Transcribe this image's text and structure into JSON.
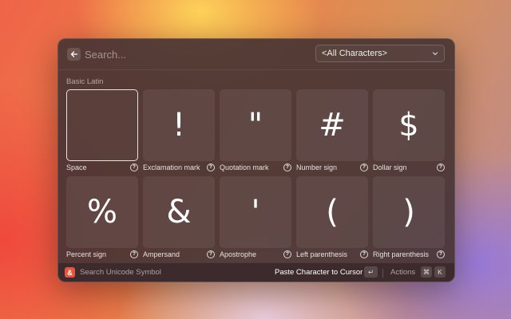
{
  "search": {
    "placeholder": "Search..."
  },
  "filter": {
    "selected": "<All Characters>"
  },
  "section": {
    "title": "Basic Latin"
  },
  "characters": [
    {
      "glyph": " ",
      "name": "Space"
    },
    {
      "glyph": "!",
      "name": "Exclamation mark"
    },
    {
      "glyph": "\"",
      "name": "Quotation mark"
    },
    {
      "glyph": "#",
      "name": "Number sign"
    },
    {
      "glyph": "$",
      "name": "Dollar sign"
    },
    {
      "glyph": "%",
      "name": "Percent sign"
    },
    {
      "glyph": "&",
      "name": "Ampersand"
    },
    {
      "glyph": "'",
      "name": "Apostrophe"
    },
    {
      "glyph": "(",
      "name": "Left parenthesis"
    },
    {
      "glyph": ")",
      "name": "Right parenthesis"
    }
  ],
  "footer": {
    "logo_glyph": "&",
    "title": "Search Unicode Symbol",
    "primary_action": "Paste Character to Cursor",
    "enter_key": "↵",
    "actions_label": "Actions",
    "cmd_key": "⌘",
    "k_key": "K"
  },
  "colors": {
    "accent": "#e8553f"
  }
}
